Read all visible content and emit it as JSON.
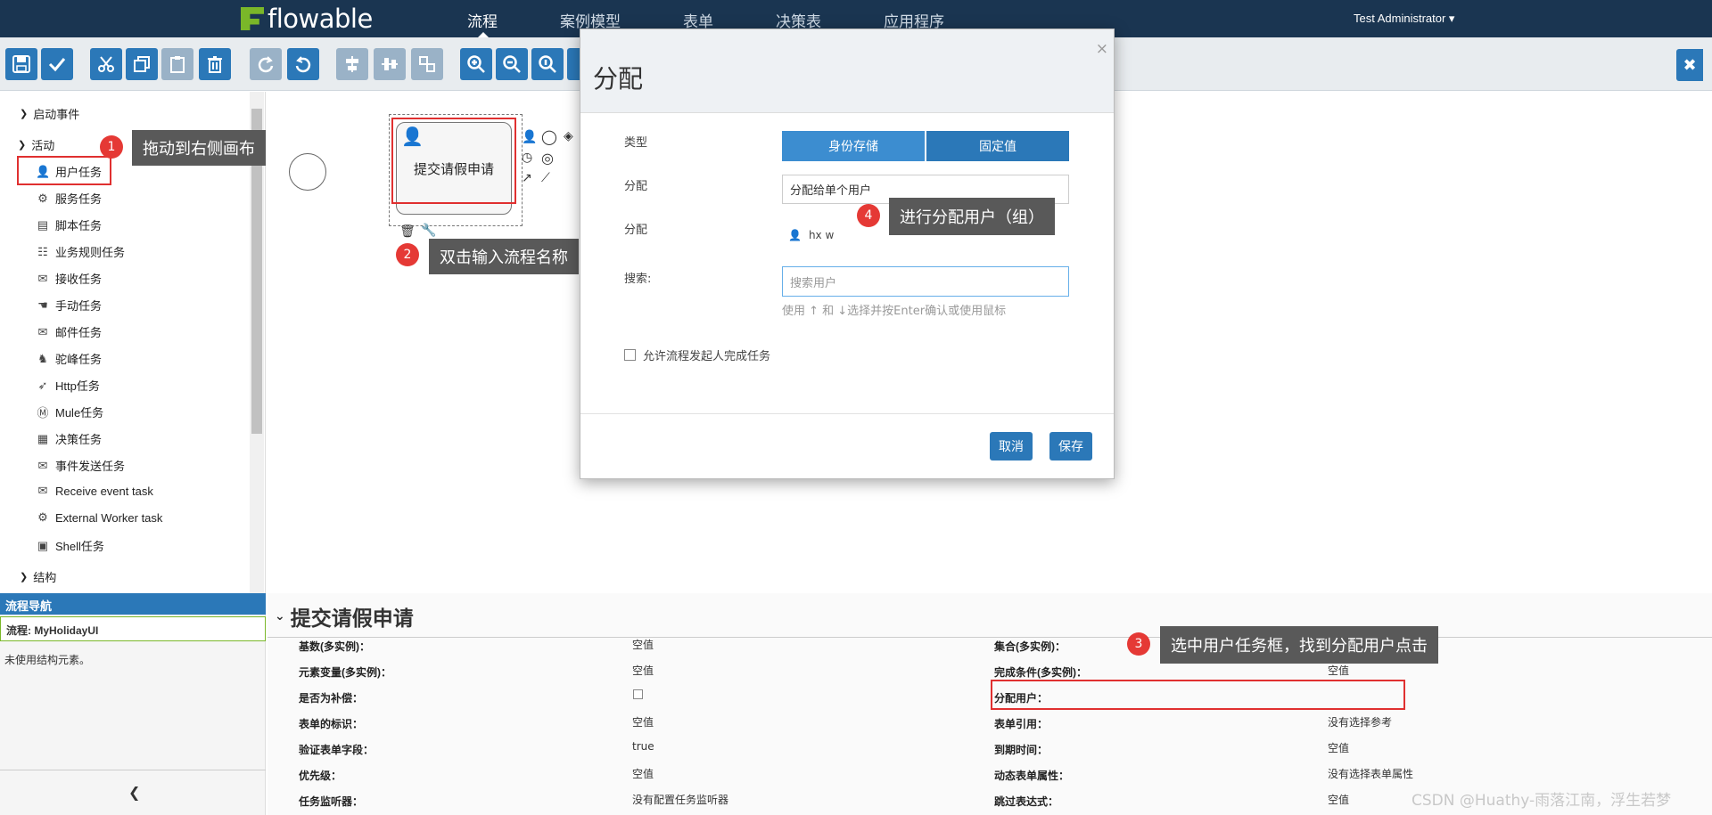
{
  "app": {
    "logo_text": "flowable",
    "user": "Test Administrator ▾"
  },
  "nav": [
    "流程",
    "案例模型",
    "表单",
    "决策表",
    "应用程序"
  ],
  "toolbar": {
    "icons": [
      "save-icon",
      "check-icon",
      "cut-icon",
      "copy-icon",
      "paste-icon",
      "delete-icon",
      "redo-icon",
      "undo-icon",
      "align-vertical-icon",
      "align-horizontal-icon",
      "same-size-icon",
      "zoom-in-icon",
      "zoom-out-icon",
      "zoom-actual-icon",
      "zoom-fit-icon"
    ]
  },
  "palette": {
    "groups": [
      {
        "label": "启动事件",
        "expanded": false
      },
      {
        "label": "活动",
        "expanded": true
      },
      {
        "label": "结构",
        "expanded": false
      }
    ],
    "items": [
      {
        "label": "用户任务",
        "icon": "user-icon"
      },
      {
        "label": "服务任务",
        "icon": "gear-icon"
      },
      {
        "label": "脚本任务",
        "icon": "script-icon"
      },
      {
        "label": "业务规则任务",
        "icon": "table-icon"
      },
      {
        "label": "接收任务",
        "icon": "envelope-icon"
      },
      {
        "label": "手动任务",
        "icon": "hand-icon"
      },
      {
        "label": "邮件任务",
        "icon": "mail-icon"
      },
      {
        "label": "驼峰任务",
        "icon": "camel-icon"
      },
      {
        "label": "Http任务",
        "icon": "rocket-icon"
      },
      {
        "label": "Mule任务",
        "icon": "mule-icon"
      },
      {
        "label": "决策任务",
        "icon": "grid-icon"
      },
      {
        "label": "事件发送任务",
        "icon": "send-icon"
      },
      {
        "label": "Receive event task",
        "icon": "envelope-icon"
      },
      {
        "label": "External Worker task",
        "icon": "gear-icon"
      },
      {
        "label": "Shell任务",
        "icon": "terminal-icon"
      }
    ]
  },
  "canvas": {
    "task_label": "提交请假申请"
  },
  "callouts": [
    {
      "num": "1",
      "text": "拖动到右侧画布"
    },
    {
      "num": "2",
      "text": "双击输入流程名称"
    },
    {
      "num": "3",
      "text": "选中用户任务框，找到分配用户点击"
    },
    {
      "num": "4",
      "text": "进行分配用户（组）"
    }
  ],
  "modal": {
    "title": "分配",
    "close": "×",
    "type_label": "类型",
    "type_options": [
      "身份存储",
      "固定值"
    ],
    "assign_label": "分配",
    "assign_select": "分配给单个用户",
    "assign_label2": "分配",
    "assigned_user": "hx w",
    "search_label": "搜索:",
    "search_placeholder": "搜索用户",
    "search_help": "使用 ↑ 和 ↓选择并按Enter确认或使用鼠标",
    "allow_initiator": "允许流程发起人完成任务",
    "cancel": "取消",
    "save": "保存"
  },
  "navigator": {
    "title": "流程导航",
    "process": "流程: MyHolidayUI",
    "empty": "未使用结构元素。"
  },
  "properties": {
    "title": "提交请假申请",
    "left": [
      {
        "label": "基数(多实例)：",
        "value": "空值"
      },
      {
        "label": "元素变量(多实例)：",
        "value": "空值"
      },
      {
        "label": "是否为补偿：",
        "value": ""
      },
      {
        "label": "表单的标识：",
        "value": "空值"
      },
      {
        "label": "验证表单字段：",
        "value": "true"
      },
      {
        "label": "优先级：",
        "value": "空值"
      },
      {
        "label": "任务监听器：",
        "value": "没有配置任务监听器"
      }
    ],
    "right": [
      {
        "label": "集合(多实例)：",
        "value": ""
      },
      {
        "label": "完成条件(多实例)：",
        "value": "空值"
      },
      {
        "label": "分配用户：",
        "value": ""
      },
      {
        "label": "表单引用：",
        "value": "没有选择参考"
      },
      {
        "label": "到期时间：",
        "value": "空值"
      },
      {
        "label": "动态表单属性：",
        "value": "没有选择表单属性"
      },
      {
        "label": "跳过表达式：",
        "value": "空值"
      }
    ]
  },
  "watermark": "CSDN @Huathy-雨落江南，浮生若梦"
}
